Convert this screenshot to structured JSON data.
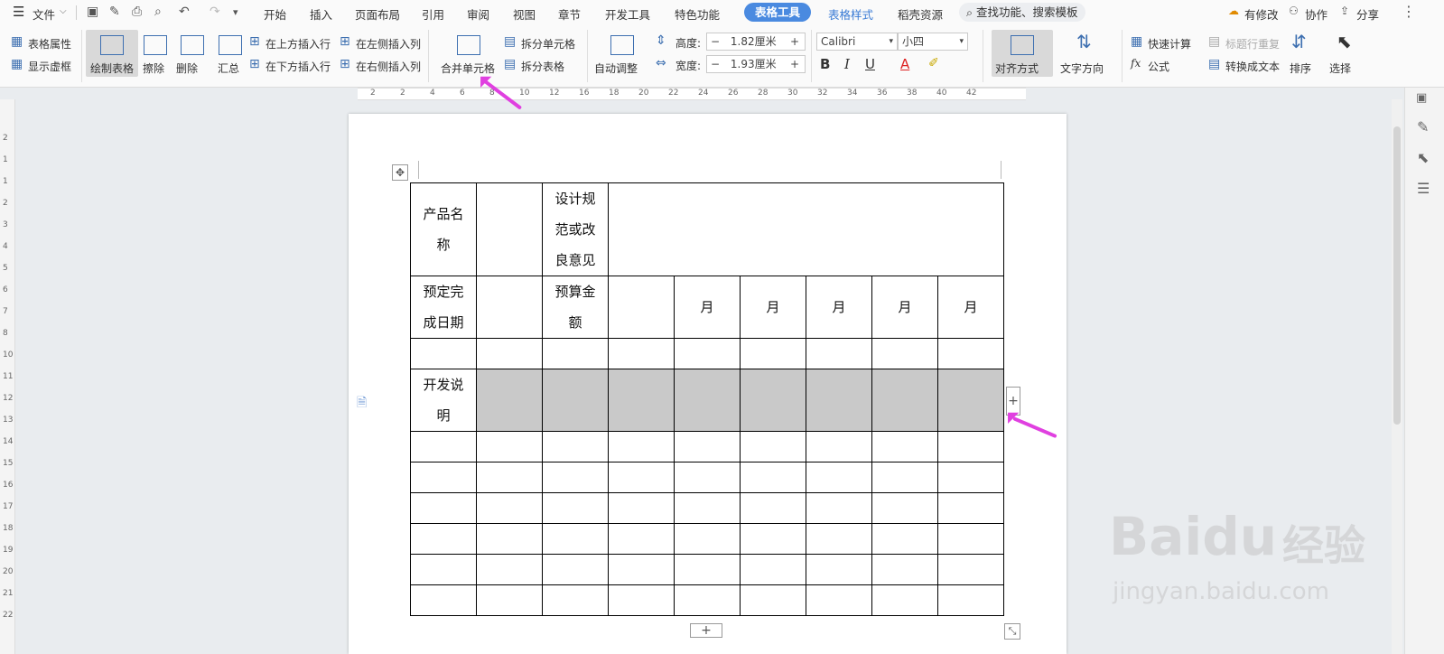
{
  "menubar": {
    "file_label": "文件",
    "tabs": [
      "开始",
      "插入",
      "页面布局",
      "引用",
      "审阅",
      "视图",
      "章节",
      "开发工具",
      "特色功能"
    ],
    "active_tab": "表格工具",
    "tabs_after": [
      "表格样式",
      "稻壳资源"
    ],
    "search_placeholder": "查找功能、搜索模板",
    "right": {
      "modified": "有修改",
      "collab": "协作",
      "share": "分享"
    }
  },
  "ribbon": {
    "table_props": "表格属性",
    "show_gridlines": "显示虚框",
    "draw_table": "绘制表格",
    "erase": "擦除",
    "delete": "删除",
    "summary": "汇总",
    "insert_row_above": "在上方插入行",
    "insert_row_below": "在下方插入行",
    "insert_col_left": "在左侧插入列",
    "insert_col_right": "在右侧插入列",
    "merge_cells": "合并单元格",
    "split_cells": "拆分单元格",
    "split_table": "拆分表格",
    "auto_fit": "自动调整",
    "height_label": "高度:",
    "height_value": "1.82厘米",
    "width_label": "宽度:",
    "width_value": "1.93厘米",
    "font_name": "Calibri",
    "font_size": "小四",
    "align": "对齐方式",
    "text_direction": "文字方向",
    "quick_calc": "快速计算",
    "repeat_header": "标题行重复",
    "formula": "公式",
    "convert_text": "转换成文本",
    "sort": "排序",
    "select": "选择"
  },
  "ruler": {
    "top_ticks": [
      "2",
      "2",
      "4",
      "6",
      "8",
      "10",
      "12",
      "16",
      "18",
      "20",
      "22",
      "24",
      "26",
      "28",
      "30",
      "32",
      "34",
      "36",
      "38",
      "40",
      "42"
    ],
    "left_ticks": [
      "2",
      "1",
      "1",
      "2",
      "3",
      "4",
      "5",
      "6",
      "7",
      "8",
      "10",
      "11",
      "12",
      "13",
      "14",
      "15",
      "16",
      "17",
      "18",
      "19",
      "20",
      "21",
      "22"
    ]
  },
  "table": {
    "row1": {
      "c1": "产品名称",
      "c3": "设计规范或改良意见"
    },
    "row2": {
      "c1": "预定完成日期",
      "c3": "预算金额",
      "month": "月"
    },
    "row4": {
      "c1": "开发说明"
    }
  },
  "watermark": {
    "brand": "Baidu",
    "brand_cn": "经验",
    "url": "jingyan.baidu.com"
  },
  "colors": {
    "accent": "#4a8ae0",
    "arrow": "#e040e0",
    "selection": "#c9c9c9"
  }
}
